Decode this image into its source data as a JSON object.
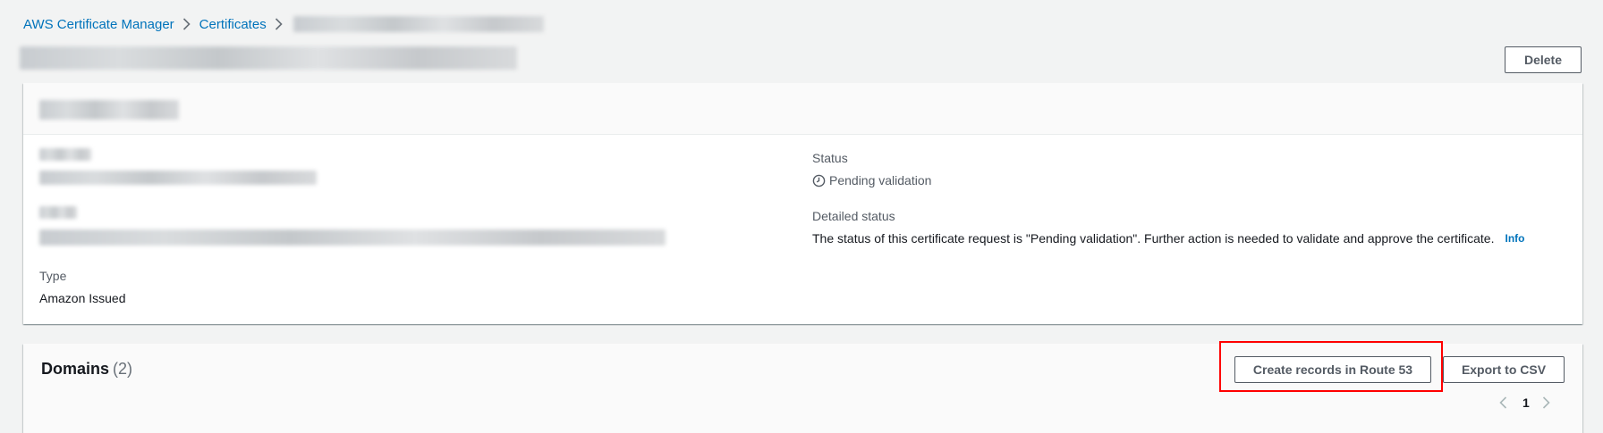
{
  "breadcrumb": {
    "items": [
      {
        "label": "AWS Certificate Manager"
      },
      {
        "label": "Certificates"
      }
    ],
    "separator_icon": "chevron-right-icon"
  },
  "header": {
    "delete_label": "Delete"
  },
  "details": {
    "status_label": "Status",
    "status_value": "Pending validation",
    "status_icon": "clock-icon",
    "detailed_status_label": "Detailed status",
    "detailed_status_value": "The status of this certificate request is \"Pending validation\". Further action is needed to validate and approve the certificate.",
    "info_label": "Info",
    "type_label": "Type",
    "type_value": "Amazon Issued"
  },
  "domains": {
    "title": "Domains",
    "count": "(2)",
    "create_records_label": "Create records in Route 53",
    "export_label": "Export to CSV",
    "page_number": "1"
  },
  "colors": {
    "link": "#0073bb",
    "highlight": "#ff0000",
    "background": "#f2f3f3"
  }
}
